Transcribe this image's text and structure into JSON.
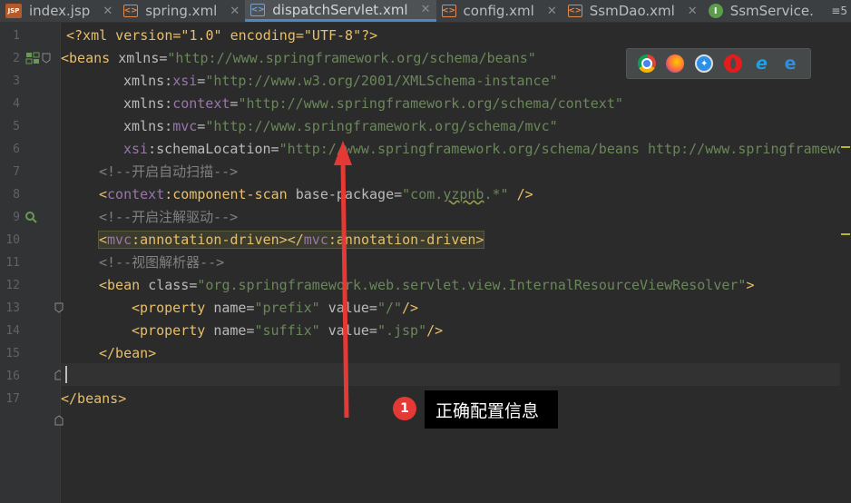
{
  "tabs": [
    {
      "label": "index.jsp",
      "icon": "jsp-file-icon",
      "active": false
    },
    {
      "label": "spring.xml",
      "icon": "xml-file-icon",
      "active": false
    },
    {
      "label": "dispatchServlet.xml",
      "icon": "xml-file-icon",
      "active": true
    },
    {
      "label": "config.xml",
      "icon": "xml-file-icon",
      "active": false
    },
    {
      "label": "SsmDao.xml",
      "icon": "xml-file-icon",
      "active": false
    },
    {
      "label": "SsmService.",
      "icon": "class-icon",
      "active": false
    }
  ],
  "tab_more": "≡5",
  "line_numbers": [
    "1",
    "2",
    "3",
    "4",
    "5",
    "6",
    "7",
    "8",
    "9",
    "10",
    "11",
    "12",
    "13",
    "14",
    "15",
    "16",
    "17"
  ],
  "code": {
    "l1": "<?xml version=\"1.0\" encoding=\"UTF-8\"?>",
    "l2_tag": "<beans ",
    "l2_attr": "xmlns=",
    "l2_val": "\"http://www.springframework.org/schema/beans\"",
    "l3_ns": "xsi",
    "l3_val": "\"http://www.w3.org/2001/XMLSchema-instance\"",
    "l4_ns": "context",
    "l4_val": "\"http://www.springframework.org/schema/context\"",
    "l5_ns": "mvc",
    "l5_val": "\"http://www.springframework.org/schema/mvc\"",
    "l6_ns": "xsi",
    "l6_attr": ":schemaLocation=",
    "l6_val": "\"http://www.springframework.org/schema/beans http://www.springframewo",
    "l7": "<!--开启自动扫描-->",
    "l8_tag": "component-scan",
    "l8_attr": "base-package=",
    "l8_val_a": "\"com.",
    "l8_val_b": "yzpnb",
    "l8_val_c": ".*\"",
    "l9": "<!--开启注解驱动-->",
    "l10_tag": "annotation-driven",
    "l11": "<!--视图解析器-->",
    "l12_val": "\"org.springframework.web.servlet.view.InternalResourceViewResolver\"",
    "l13_name": "\"prefix\"",
    "l13_value": "\"/\"",
    "l14_name": "\"suffix\"",
    "l14_value": "\".jsp\"",
    "l15": "</bean>",
    "l17": "</beans>"
  },
  "browsers": [
    "chrome-icon",
    "firefox-icon",
    "safari-icon",
    "opera-icon",
    "ie-icon",
    "edge-icon"
  ],
  "annotation": {
    "badge": "1",
    "text": "正确配置信息"
  },
  "colors": {
    "arrow": "#e53935",
    "tag": "#e8bf6a",
    "value": "#6a8759",
    "comment": "#808080",
    "namespace": "#9876aa"
  }
}
